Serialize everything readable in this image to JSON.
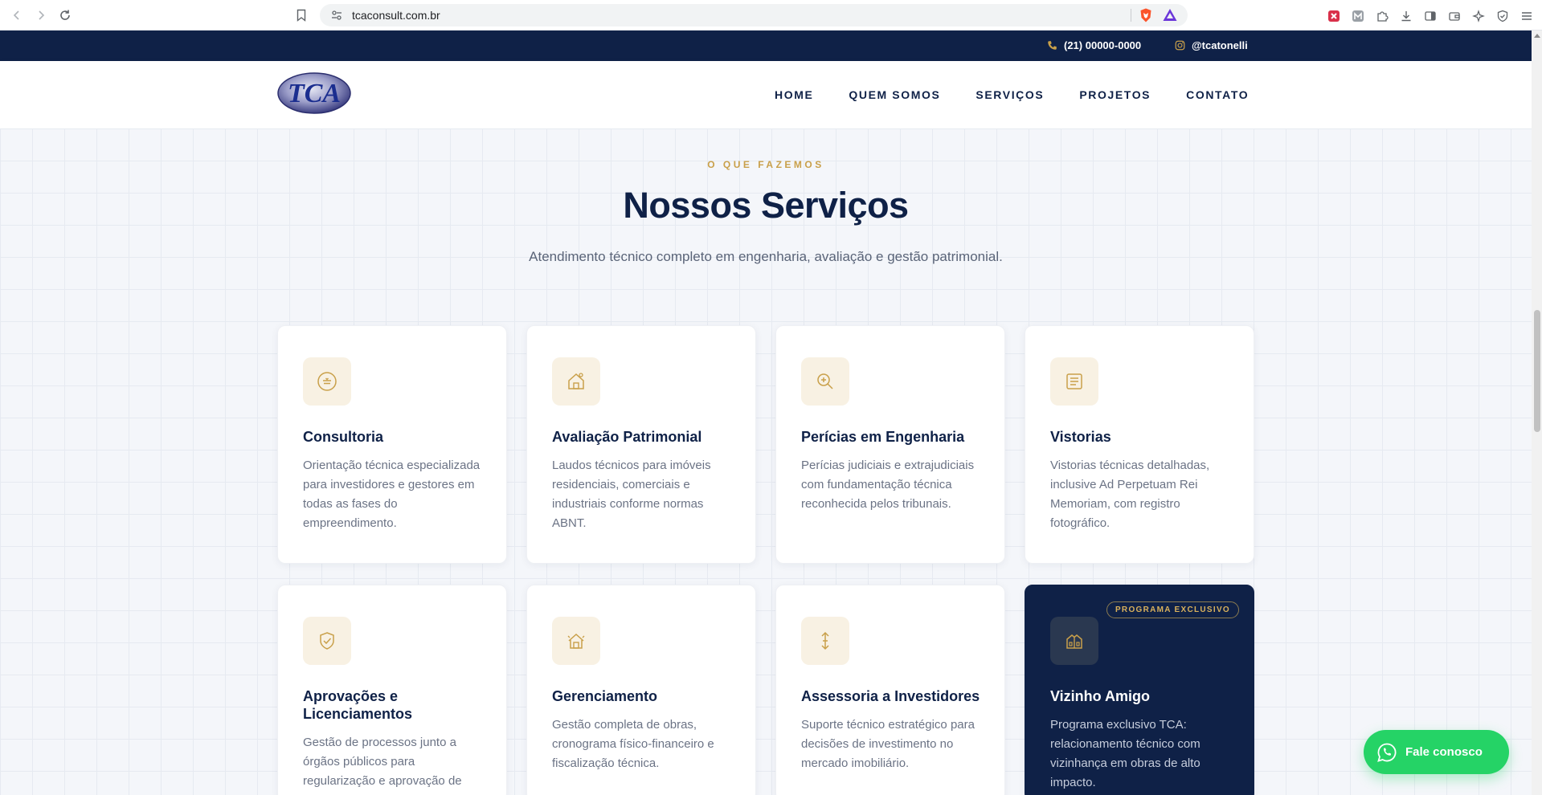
{
  "browser": {
    "url": "tcaconsult.com.br"
  },
  "topbar": {
    "phone": "(21) 00000-0000",
    "instagram": "@tcatonelli"
  },
  "header": {
    "logo_text": "TCA",
    "menu": [
      "HOME",
      "QUEM SOMOS",
      "SERVIÇOS",
      "PROJETOS",
      "CONTATO"
    ]
  },
  "section": {
    "eyebrow": "O QUE FAZEMOS",
    "title": "Nossos Serviços",
    "subtitle": "Atendimento técnico completo em engenharia, avaliação e gestão patrimonial."
  },
  "cards": [
    {
      "title": "Consultoria",
      "text": "Orientação técnica especializada para investidores e gestores em todas as fases do empreendimento.",
      "icon": "consulting-icon"
    },
    {
      "title": "Avaliação Patrimonial",
      "text": "Laudos técnicos para imóveis residenciais, comerciais e industriais conforme normas ABNT.",
      "icon": "house-icon"
    },
    {
      "title": "Perícias em Engenharia",
      "text": "Perícias judiciais e extrajudiciais com fundamentação técnica reconhecida pelos tribunais.",
      "icon": "magnifier-icon"
    },
    {
      "title": "Vistorias",
      "text": "Vistorias técnicas detalhadas, inclusive Ad Perpetuam Rei Memoriam, com registro fotográfico.",
      "icon": "document-icon"
    },
    {
      "title": "Aprovações e Licenciamentos",
      "text": "Gestão de processos junto a órgãos públicos para regularização e aprovação de",
      "icon": "shield-check-icon"
    },
    {
      "title": "Gerenciamento",
      "text": "Gestão completa de obras, cronograma físico-financeiro e fiscalização técnica.",
      "icon": "building-icon"
    },
    {
      "title": "Assessoria a Investidores",
      "text": "Suporte técnico estratégico para decisões de investimento no mercado imobiliário.",
      "icon": "arrows-vertical-icon"
    },
    {
      "title": "Vizinho Amigo",
      "text": "Programa exclusivo TCA: relacionamento técnico com vizinhança em obras de alto impacto.",
      "icon": "neighbor-icon",
      "badge": "PROGRAMA EXCLUSIVO"
    }
  ],
  "whatsapp": {
    "label": "Fale conosco"
  },
  "colors": {
    "navy": "#0f2147",
    "gold": "#c9a04a",
    "whatsapp": "#25d366"
  }
}
